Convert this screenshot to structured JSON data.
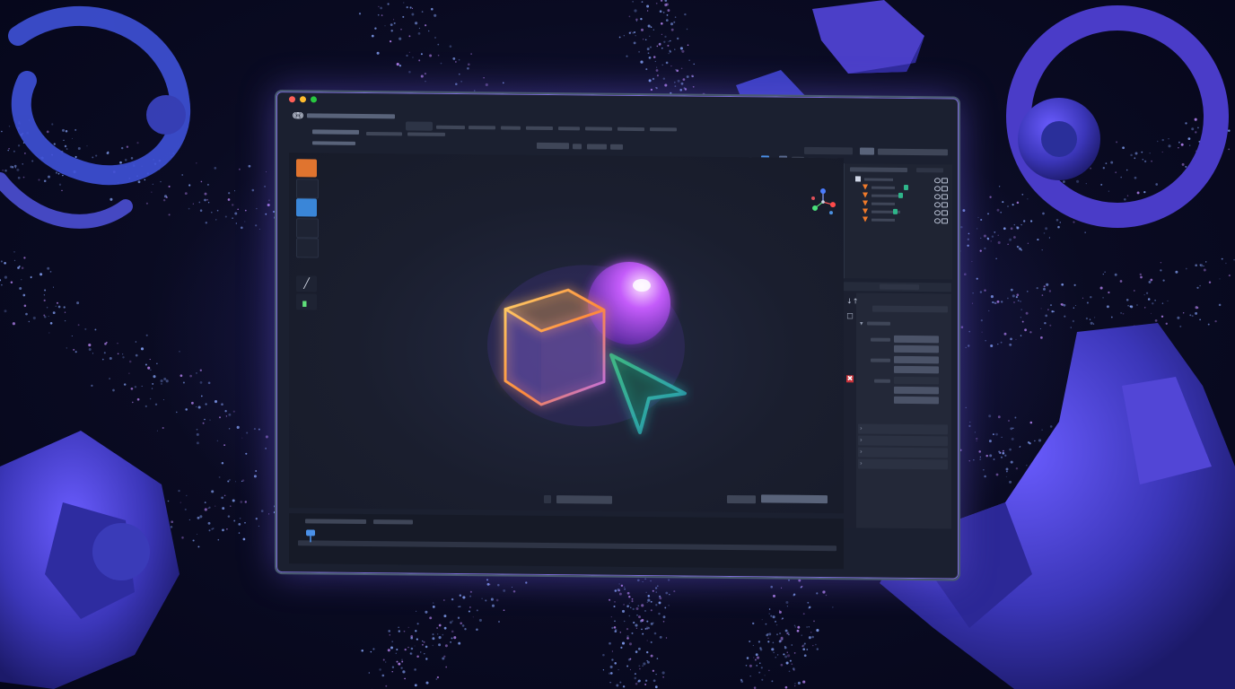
{
  "window": {
    "title": "",
    "traffic_lights": {
      "close": "#ff5f57",
      "minimize": "#febc2e",
      "zoom": "#28c840"
    },
    "app_logo_glyph": "ↈ"
  },
  "tools": [
    {
      "name": "orange-swatch",
      "color": "#e0742f"
    },
    {
      "name": "blue-swatch",
      "color": "#3a86d8"
    },
    {
      "name": "pen-tool-icon",
      "glyph": "╱"
    },
    {
      "name": "chart-tool-icon",
      "glyph": "▖"
    }
  ],
  "properties": {
    "side_tabs": [
      {
        "glyph": "↓↑"
      },
      {
        "glyph": "□"
      },
      {
        "glyph": "✖"
      }
    ]
  },
  "viewport": {
    "hero_icon": "cube-sphere-cursor",
    "hero_colors": {
      "cube": "#ffb24a",
      "sphere": "#f08cff",
      "cursor": "#3cff8a"
    }
  },
  "outliner": {
    "rows": [
      {
        "type": "scene",
        "icon_color": "#cfd6e6"
      },
      {
        "type": "cone",
        "icon_color": "#f07a2a"
      },
      {
        "type": "cone",
        "icon_color": "#f07a2a"
      },
      {
        "type": "cone",
        "icon_color": "#f07a2a"
      },
      {
        "type": "cone",
        "icon_color": "#f07a2a"
      },
      {
        "type": "cone",
        "icon_color": "#f07a2a"
      }
    ]
  },
  "colors": {
    "accent": "#7c6bd8",
    "panel": "#1f2433",
    "viewport": "#1a1e2e"
  }
}
